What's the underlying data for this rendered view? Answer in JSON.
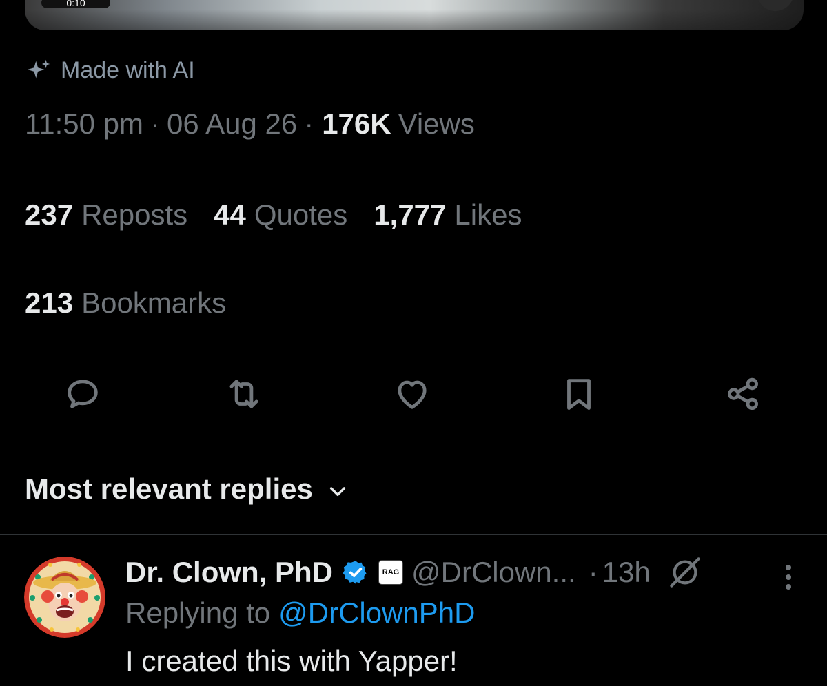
{
  "media": {
    "duration_label": "0:10"
  },
  "ai_label": {
    "icon": "sparkle-icon",
    "text": "Made with AI"
  },
  "meta": {
    "time": "11:50 pm",
    "separator": "·",
    "date": "06 Aug 26",
    "views_count": "176K",
    "views_label": "Views"
  },
  "stats": {
    "reposts_count": "237",
    "reposts_label": "Reposts",
    "quotes_count": "44",
    "quotes_label": "Quotes",
    "likes_count": "1,777",
    "likes_label": "Likes",
    "bookmarks_count": "213",
    "bookmarks_label": "Bookmarks"
  },
  "actions": [
    {
      "name": "reply",
      "icon": "reply-bubble-icon"
    },
    {
      "name": "repost",
      "icon": "repost-icon"
    },
    {
      "name": "like",
      "icon": "heart-icon"
    },
    {
      "name": "bookmark",
      "icon": "bookmark-icon"
    },
    {
      "name": "share",
      "icon": "share-icon"
    }
  ],
  "replies_sort": {
    "label": "Most relevant replies",
    "icon": "chevron-down-icon"
  },
  "reply": {
    "display_name": "Dr. Clown, PhD",
    "verified_icon": "verified-badge-icon",
    "affiliate_badge": "RAG",
    "handle": "@DrClown...",
    "separator": "·",
    "time": "13h",
    "grok_icon": "grok-icon",
    "more_icon": "more-vertical-icon",
    "replying_prefix": "Replying to",
    "replying_mention": "@DrClownPhD",
    "text": "I created this with Yapper!"
  },
  "colors": {
    "background": "#000000",
    "primary_text": "#e7e9ea",
    "secondary_text": "#71767b",
    "accent": "#1d9bf0",
    "divider": "#2f3336"
  }
}
